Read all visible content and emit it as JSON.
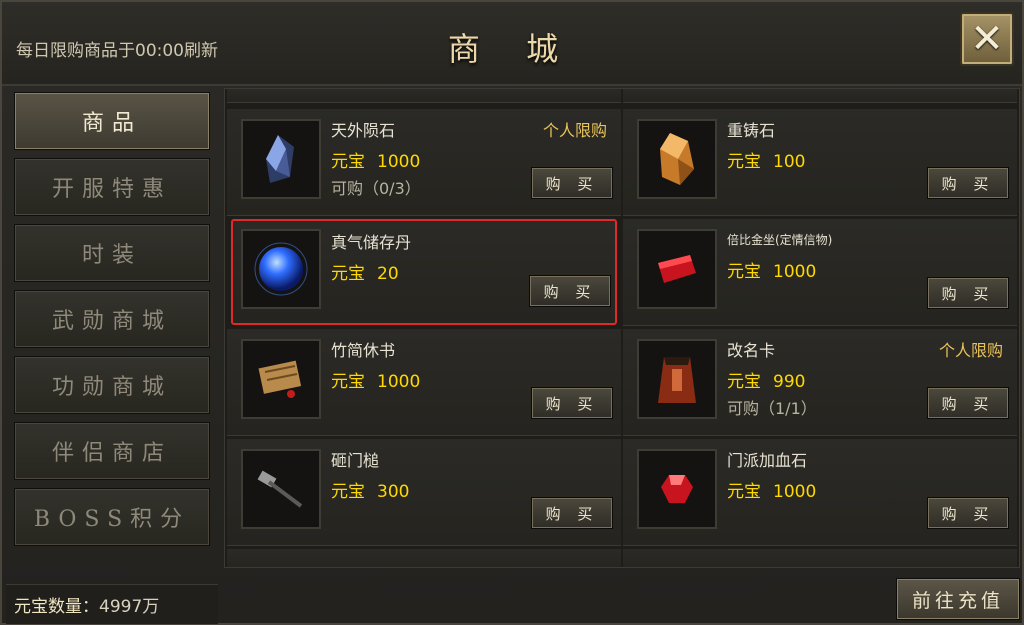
{
  "header": {
    "refresh_note": "每日限购商品于00:00刷新",
    "title": "商 城",
    "close_icon": "close-icon"
  },
  "sidebar": {
    "items": [
      {
        "label": "商品",
        "active": true
      },
      {
        "label": "开服特惠",
        "active": false
      },
      {
        "label": "时装",
        "active": false
      },
      {
        "label": "武勋商城",
        "active": false
      },
      {
        "label": "功勋商城",
        "active": false
      },
      {
        "label": "伴侣商店",
        "active": false
      },
      {
        "label": "BOSS积分",
        "active": false
      }
    ]
  },
  "currency_label": "元宝",
  "buy_label": "购 买",
  "products": [
    {
      "name": "天外陨石",
      "price": "1000",
      "limit": "个人限购",
      "quota": "可购（0/3）",
      "icon": "meteorite-icon"
    },
    {
      "name": "重铸石",
      "price": "100",
      "limit": "",
      "quota": "",
      "icon": "recast-stone-icon"
    },
    {
      "name": "真气储存丹",
      "price": "20",
      "limit": "",
      "quota": "",
      "icon": "blue-orb-icon",
      "highlighted": true
    },
    {
      "name": "倍比金坐(定情信物)",
      "price": "1000",
      "limit": "",
      "quota": "",
      "icon": "red-pouch-icon"
    },
    {
      "name": "竹简休书",
      "price": "1000",
      "limit": "",
      "quota": "",
      "icon": "scroll-icon"
    },
    {
      "name": "改名卡",
      "price": "990",
      "limit": "个人限购",
      "quota": "可购（1/1）",
      "icon": "rename-card-icon"
    },
    {
      "name": "砸门槌",
      "price": "300",
      "limit": "",
      "quota": "",
      "icon": "hammer-icon"
    },
    {
      "name": "门派加血石",
      "price": "1000",
      "limit": "",
      "quota": "",
      "icon": "red-gem-icon"
    }
  ],
  "footer": {
    "balance_label": "元宝数量：",
    "balance_value": "4997万",
    "recharge_label": "前往充值"
  },
  "colors": {
    "price": "#ffd800",
    "limit": "#e8c35a",
    "highlight_border": "#e02a2a"
  }
}
